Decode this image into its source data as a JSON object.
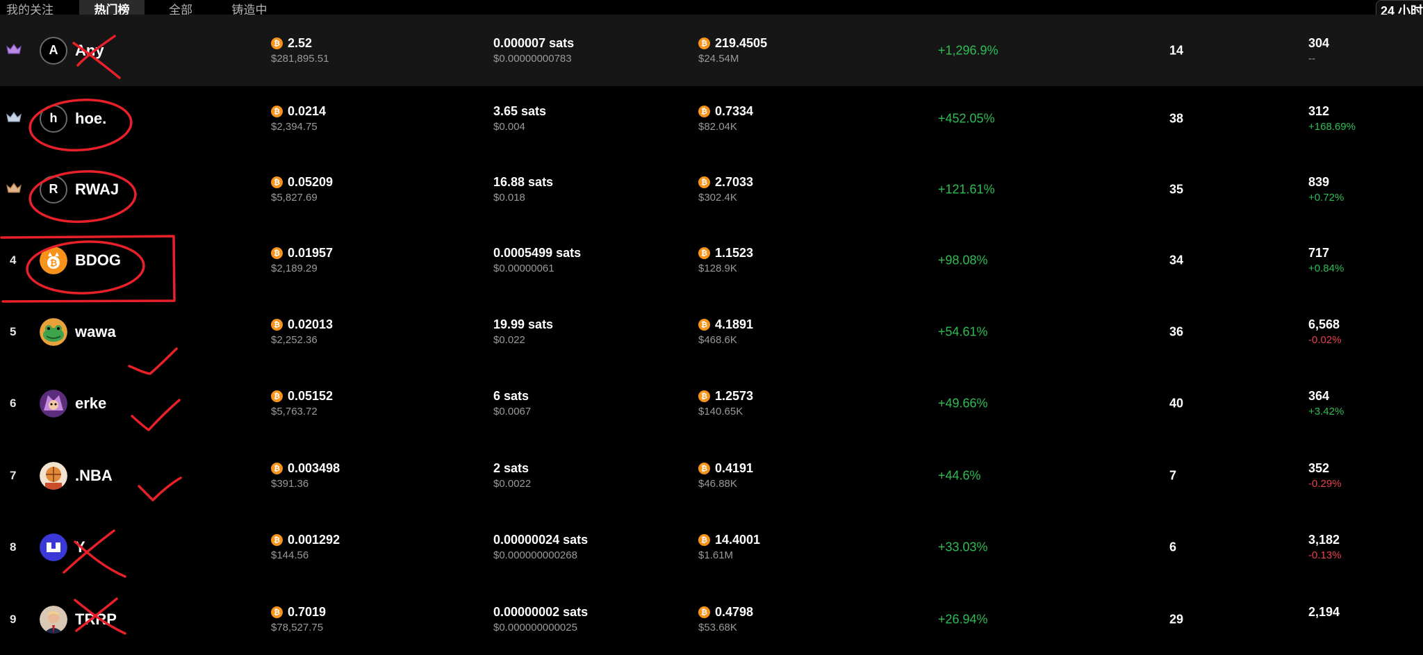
{
  "tabs": [
    {
      "label": "我的关注",
      "active": false
    },
    {
      "label": "热门榜",
      "active": true
    },
    {
      "label": "全部",
      "active": false
    },
    {
      "label": "铸造中",
      "active": false
    }
  ],
  "time_button": {
    "label": "24 小时"
  },
  "colors": {
    "positive": "#2ebd55",
    "negative": "#e5414f",
    "btc": "#f7931a",
    "annotation": "#e8202a"
  },
  "rows": [
    {
      "rank": "",
      "crown": "purple",
      "avatar": "A",
      "avatar_icon": "letter-avatar",
      "name": "Any",
      "price_btc": "2.52",
      "price_usd": "$281,895.51",
      "unit_sats": "0.000007 sats",
      "unit_usd": "$0.00000000783",
      "vol_btc": "219.4505",
      "vol_usd": "$24.54M",
      "change": "+1,296.9%",
      "holders": "14",
      "txn": "304",
      "txn_change": "--",
      "txn_trend": "flat"
    },
    {
      "rank": "",
      "crown": "silver",
      "avatar": "h",
      "avatar_icon": "letter-avatar",
      "name": "hoe.",
      "price_btc": "0.0214",
      "price_usd": "$2,394.75",
      "unit_sats": "3.65 sats",
      "unit_usd": "$0.004",
      "vol_btc": "0.7334",
      "vol_usd": "$82.04K",
      "change": "+452.05%",
      "holders": "38",
      "txn": "312",
      "txn_change": "+168.69%",
      "txn_trend": "pos"
    },
    {
      "rank": "",
      "crown": "bronze",
      "avatar": "R",
      "avatar_icon": "letter-avatar",
      "name": "RWAJ",
      "price_btc": "0.05209",
      "price_usd": "$5,827.69",
      "unit_sats": "16.88 sats",
      "unit_usd": "$0.018",
      "vol_btc": "2.7033",
      "vol_usd": "$302.4K",
      "change": "+121.61%",
      "holders": "35",
      "txn": "839",
      "txn_change": "+0.72%",
      "txn_trend": "pos"
    },
    {
      "rank": "4",
      "crown": "",
      "avatar": "",
      "avatar_icon": "bitcoin-dog-icon",
      "name": "BDOG",
      "price_btc": "0.01957",
      "price_usd": "$2,189.29",
      "unit_sats": "0.0005499 sats",
      "unit_usd": "$0.00000061",
      "vol_btc": "1.1523",
      "vol_usd": "$128.9K",
      "change": "+98.08%",
      "holders": "34",
      "txn": "717",
      "txn_change": "+0.84%",
      "txn_trend": "pos"
    },
    {
      "rank": "5",
      "crown": "",
      "avatar": "",
      "avatar_icon": "frog-icon",
      "name": "wawa",
      "price_btc": "0.02013",
      "price_usd": "$2,252.36",
      "unit_sats": "19.99 sats",
      "unit_usd": "$0.022",
      "vol_btc": "4.1891",
      "vol_usd": "$468.6K",
      "change": "+54.61%",
      "holders": "36",
      "txn": "6,568",
      "txn_change": "-0.02%",
      "txn_trend": "neg"
    },
    {
      "rank": "6",
      "crown": "",
      "avatar": "",
      "avatar_icon": "purple-character-icon",
      "name": "erke",
      "price_btc": "0.05152",
      "price_usd": "$5,763.72",
      "unit_sats": "6 sats",
      "unit_usd": "$0.0067",
      "vol_btc": "1.2573",
      "vol_usd": "$140.65K",
      "change": "+49.66%",
      "holders": "40",
      "txn": "364",
      "txn_change": "+3.42%",
      "txn_trend": "pos"
    },
    {
      "rank": "7",
      "crown": "",
      "avatar": "",
      "avatar_icon": "basketball-character-icon",
      "name": ".NBA",
      "price_btc": "0.003498",
      "price_usd": "$391.36",
      "unit_sats": "2 sats",
      "unit_usd": "$0.0022",
      "vol_btc": "0.4191",
      "vol_usd": "$46.88K",
      "change": "+44.6%",
      "holders": "7",
      "txn": "352",
      "txn_change": "-0.29%",
      "txn_trend": "neg"
    },
    {
      "rank": "8",
      "crown": "",
      "avatar": "",
      "avatar_icon": "blue-logo-icon",
      "name": "Y",
      "price_btc": "0.001292",
      "price_usd": "$144.56",
      "unit_sats": "0.00000024 sats",
      "unit_usd": "$0.000000000268",
      "vol_btc": "14.4001",
      "vol_usd": "$1.61M",
      "change": "+33.03%",
      "holders": "6",
      "txn": "3,182",
      "txn_change": "-0.13%",
      "txn_trend": "neg"
    },
    {
      "rank": "9",
      "crown": "",
      "avatar": "",
      "avatar_icon": "portrait-icon",
      "name": "TRRP",
      "price_btc": "0.7019",
      "price_usd": "$78,527.75",
      "unit_sats": "0.00000002 sats",
      "unit_usd": "$0.000000000025",
      "vol_btc": "0.4798",
      "vol_usd": "$53.68K",
      "change": "+26.94%",
      "holders": "29",
      "txn": "2,194",
      "txn_change": "",
      "txn_trend": "pos"
    }
  ]
}
